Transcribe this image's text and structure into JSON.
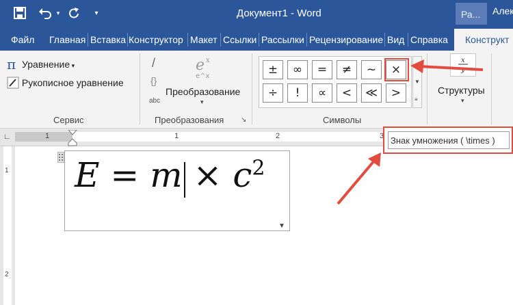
{
  "titlebar": {
    "document_title": "Документ1  -  Word",
    "ribbon_display_short": "Ра...",
    "user_name": "Алек",
    "qa_icons": {
      "save": "save-icon",
      "undo": "undo-icon",
      "redo": "redo-icon",
      "customize": "customize-icon"
    }
  },
  "tabs": {
    "items": [
      "Файл",
      "Главная",
      "Вставка",
      "Конструктор",
      "Макет",
      "Ссылки",
      "Рассылки",
      "Рецензирование",
      "Вид",
      "Справка"
    ],
    "active": "Конструкт"
  },
  "ribbon": {
    "service": {
      "equation_label": "Уравнение",
      "ink_equation_label": "Рукописное уравнение",
      "group_label": "Сервис"
    },
    "conversions": {
      "convert_label": "Преобразование",
      "abc_label": "abc",
      "group_label": "Преобразования"
    },
    "symbols": {
      "row1": [
        "±",
        "∞",
        "=",
        "≠",
        "~",
        "×"
      ],
      "row2": [
        "÷",
        "!",
        "∝",
        "<",
        "≪",
        ">"
      ],
      "group_label": "Символы"
    },
    "structures": {
      "label": "Структуры"
    }
  },
  "ruler": {
    "numbers": [
      "1",
      "1",
      "2",
      "3"
    ]
  },
  "vruler": {
    "numbers": [
      "1",
      "2"
    ]
  },
  "document": {
    "equation": {
      "E": "E",
      "eq": "=",
      "m": "m",
      "times": "×",
      "c": "c",
      "exp": "2"
    }
  },
  "tooltip": {
    "text": "Знак умножения ( \\times )"
  },
  "accent": {
    "word_blue": "#2b579a",
    "highlight_red": "#e24c3f"
  }
}
